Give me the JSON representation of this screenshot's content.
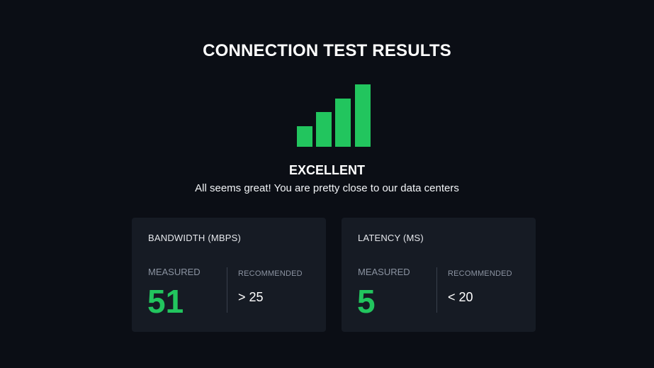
{
  "page": {
    "title": "CONNECTION TEST RESULTS"
  },
  "status": {
    "label": "EXCELLENT",
    "message": "All seems great! You are pretty close to our data centers",
    "signal_icon": "signal-strength-icon",
    "signal_level": 4,
    "signal_max": 4
  },
  "colors": {
    "background": "#0b0e15",
    "card": "#161b24",
    "accent_green": "#22c55e",
    "muted_text": "#8b93a1"
  },
  "cards": {
    "bandwidth": {
      "title": "BANDWIDTH (MBPS)",
      "measured_label": "MEASURED",
      "measured_value": "51",
      "recommended_label": "RECOMMENDED",
      "recommended_value": "> 25"
    },
    "latency": {
      "title": "LATENCY (MS)",
      "measured_label": "MEASURED",
      "measured_value": "5",
      "recommended_label": "RECOMMENDED",
      "recommended_value": "< 20"
    }
  }
}
